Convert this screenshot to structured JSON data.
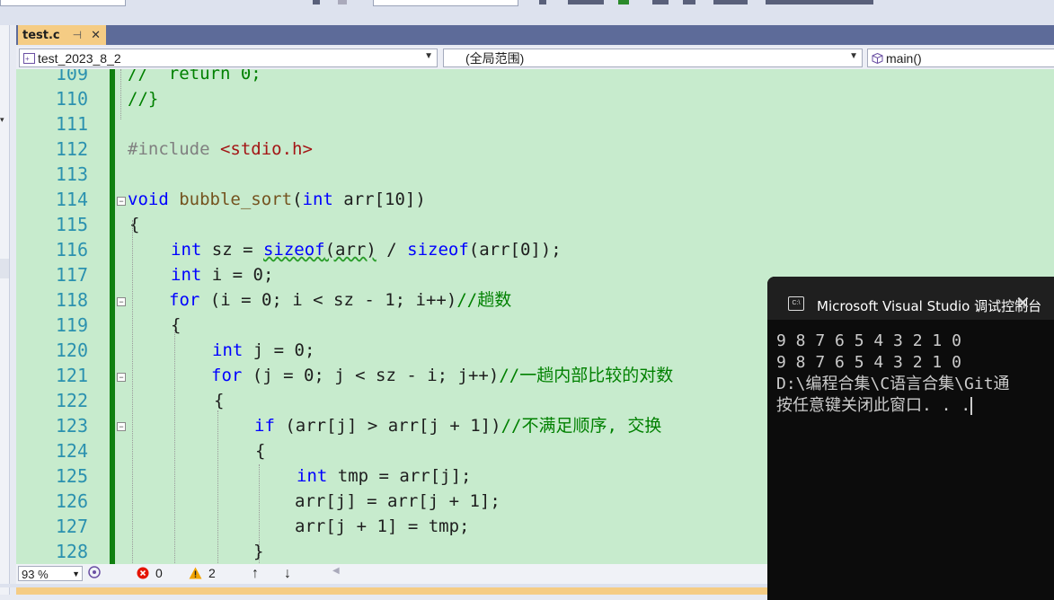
{
  "tab": {
    "name": "test.c",
    "pin": "⊣",
    "close": "✕"
  },
  "nav": {
    "project": "test_2023_8_2",
    "scope": "(全局范围)",
    "member": "main()"
  },
  "lines": [
    {
      "n": "109"
    },
    {
      "n": "110"
    },
    {
      "n": "111"
    },
    {
      "n": "112"
    },
    {
      "n": "113"
    },
    {
      "n": "114"
    },
    {
      "n": "115"
    },
    {
      "n": "116"
    },
    {
      "n": "117"
    },
    {
      "n": "118"
    },
    {
      "n": "119"
    },
    {
      "n": "120"
    },
    {
      "n": "121"
    },
    {
      "n": "122"
    },
    {
      "n": "123"
    },
    {
      "n": "124"
    },
    {
      "n": "125"
    },
    {
      "n": "126"
    },
    {
      "n": "127"
    },
    {
      "n": "128"
    }
  ],
  "code": {
    "l109": "//  return 0;",
    "l110": "//}",
    "l112_a": "#include ",
    "l112_b": "<stdio.h>",
    "l114_kw": "void",
    "l114_fn": "bubble_sort",
    "l114_p1": "(",
    "l114_kw2": "int",
    "l114_rest": " arr[10])",
    "l115": "{",
    "l116_kw": "int",
    "l116_v": " sz = ",
    "l116_fn": "sizeof",
    "l116_a": "(arr)",
    "l116_b": " / ",
    "l116_fn2": "sizeof",
    "l116_c": "(arr[0]);",
    "l117_kw": "int",
    "l117_rest": " i = 0;",
    "l118_kw": "for",
    "l118_rest": " (i = 0; i < sz - 1; i++)",
    "l118_cm": "//趟数",
    "l119": "{",
    "l120_kw": "int",
    "l120_rest": " j = 0;",
    "l121_kw": "for",
    "l121_rest": " (j = 0; j < sz - i; j++)",
    "l121_cm": "//一趟内部比较的对数",
    "l122": "{",
    "l123_kw": "if",
    "l123_rest": " (arr[j] > arr[j + 1])",
    "l123_cm": "//不满足顺序, 交换",
    "l124": "{",
    "l125_kw": "int",
    "l125_rest": " tmp = arr[j];",
    "l126": "arr[j] = arr[j + 1];",
    "l127": "arr[j + 1] = tmp;",
    "l128": "}"
  },
  "status": {
    "zoom": "93 %",
    "errors": "0",
    "warnings": "2",
    "up": "↑",
    "down": "↓"
  },
  "console": {
    "title": "Microsoft Visual Studio 调试控制台",
    "close": "✕",
    "line1": "9 8 7 6 5 4 3 2 1 0",
    "line2": "9 8 7 6 5 4 3 2 1 0",
    "line3": "D:\\编程合集\\C语言合集\\Git通",
    "line4": "按任意键关闭此窗口. . ."
  },
  "colors": {
    "editor_bg": "#c7ebcd",
    "tab_active": "#f5cc84",
    "keyword": "#0000ff",
    "comment": "#008000",
    "string": "#a31515"
  }
}
